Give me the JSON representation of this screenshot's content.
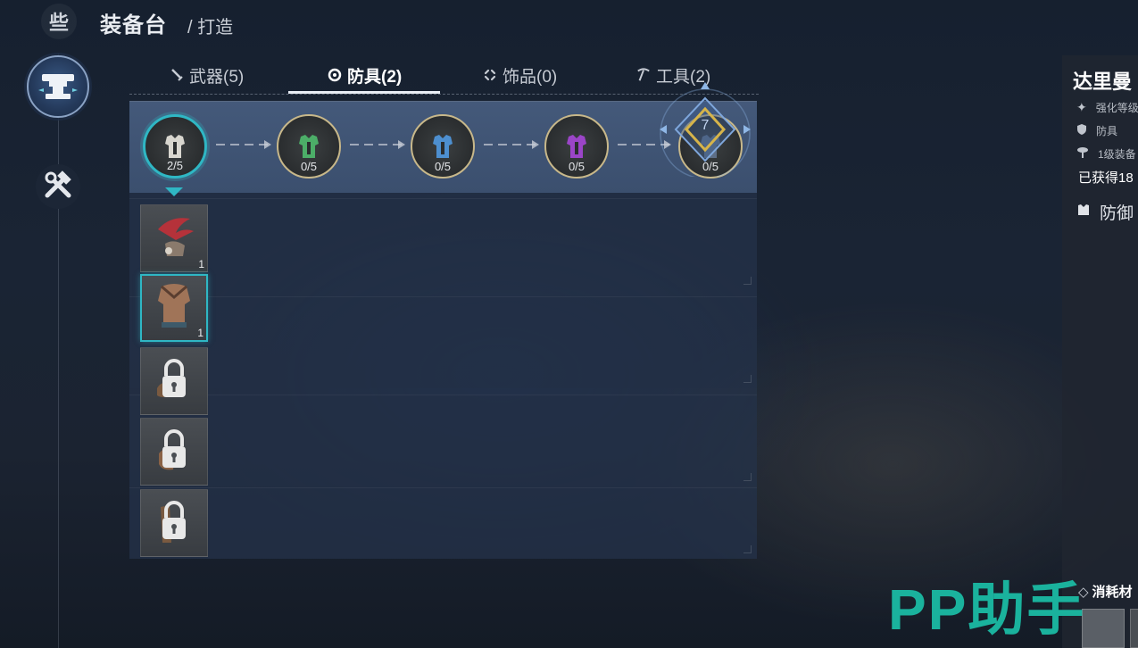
{
  "header": {
    "back_glyph": "些",
    "title": "装备台",
    "subtitle": "/ 打造"
  },
  "tabs": [
    {
      "label": "武器(5)",
      "icon": "sword-icon",
      "active": false
    },
    {
      "label": "防具(2)",
      "icon": "armor-ring-icon",
      "active": true
    },
    {
      "label": "饰品(0)",
      "icon": "accessory-icon",
      "active": false
    },
    {
      "label": "工具(2)",
      "icon": "pickaxe-icon",
      "active": false
    }
  ],
  "progress_nodes": [
    {
      "count": "2/5",
      "color": "#d8d6cf",
      "active": true
    },
    {
      "count": "0/5",
      "color": "#4cae68",
      "active": false
    },
    {
      "count": "0/5",
      "color": "#4d8fd0",
      "active": false
    },
    {
      "count": "0/5",
      "color": "#9b45c8",
      "active": false
    },
    {
      "count": "0/5",
      "color": "#6f86a8",
      "active": false,
      "badge": "7"
    }
  ],
  "items": [
    {
      "qty": "1",
      "locked": false,
      "selected": false,
      "kind": "feather-headgear"
    },
    {
      "qty": "1",
      "locked": false,
      "selected": true,
      "kind": "torso-wrap"
    },
    {
      "qty": "",
      "locked": true,
      "selected": false,
      "kind": "gloves"
    },
    {
      "qty": "",
      "locked": true,
      "selected": false,
      "kind": "bracers"
    },
    {
      "qty": "",
      "locked": true,
      "selected": false,
      "kind": "belt"
    }
  ],
  "info": {
    "name": "达里曼",
    "lines": [
      "强化等级",
      "防具",
      "1级装备"
    ],
    "acquired": "已获得18",
    "defense_label": "防御"
  },
  "consumables_label": "消耗材",
  "watermark": "PP助手",
  "colors": {
    "accent": "#2fb7c4",
    "gold": "#c8b88a",
    "watermark": "#1bbfa7"
  }
}
